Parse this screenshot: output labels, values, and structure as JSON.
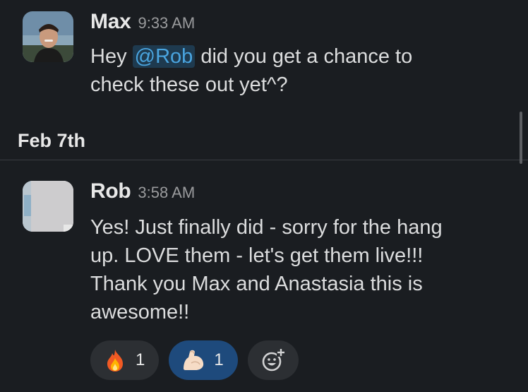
{
  "messages": [
    {
      "sender": "Max",
      "time": "9:33 AM",
      "text_before": "Hey",
      "mention": "@Rob",
      "text_after_line1": "did you get a chance to",
      "text_line2": "check these out yet^?"
    },
    {
      "sender": "Rob",
      "time": "3:58 AM",
      "lines": [
        "Yes! Just finally did - sorry for the hang",
        "up. LOVE them - let's get them live!!!",
        "Thank you Max and Anastasia this is",
        "awesome!!"
      ]
    }
  ],
  "date_divider": "Feb 7th",
  "reactions": [
    {
      "emoji": "fire-emoji",
      "count": "1",
      "active": false
    },
    {
      "emoji": "flexed-biceps-emoji",
      "count": "1",
      "active": true
    }
  ],
  "add_reaction_icon": "add-reaction-icon",
  "colors": {
    "background": "#1a1d21",
    "mention_text": "#4aa5e0",
    "mention_bg": "#1e3a4f",
    "active_reaction": "#1e4a7c",
    "reaction_bg": "#2c2f33"
  }
}
